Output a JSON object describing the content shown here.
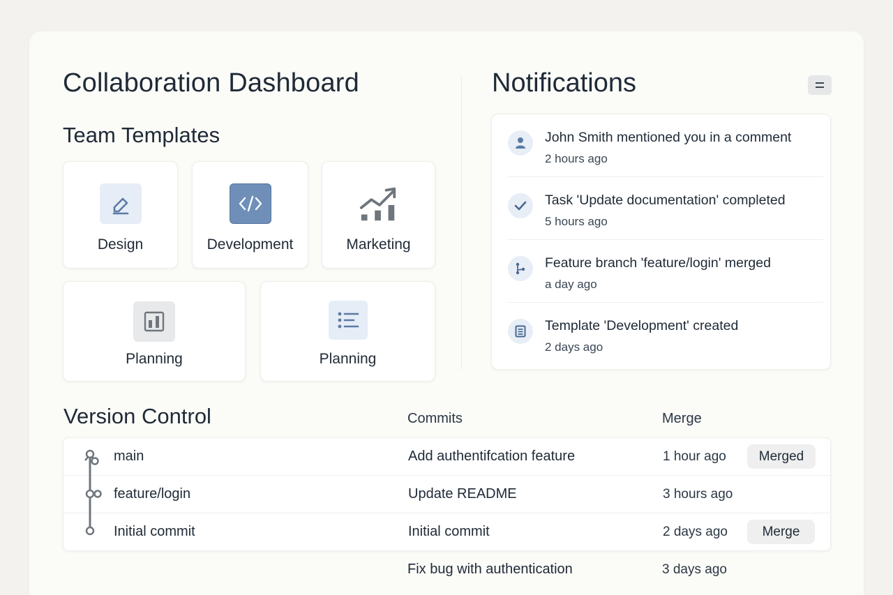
{
  "title": "Collaboration Dashboard",
  "templates": {
    "heading": "Team Templates",
    "items": [
      {
        "label": "Design",
        "icon": "pencil-icon"
      },
      {
        "label": "Development",
        "icon": "code-icon"
      },
      {
        "label": "Marketing",
        "icon": "growth-chart-icon"
      },
      {
        "label": "Planning",
        "icon": "bar-chart-icon"
      },
      {
        "label": "Planning",
        "icon": "list-icon"
      }
    ]
  },
  "notifications": {
    "heading": "Notifications",
    "menu_icon": "menu-icon",
    "items": [
      {
        "text": "John Smith mentioned you in a comment",
        "time": "2 hours ago",
        "icon": "user-icon"
      },
      {
        "text": "Task 'Update documentation' completed",
        "time": "5 hours ago",
        "icon": "check-icon"
      },
      {
        "text": "Feature branch 'feature/login' merged",
        "time": "a day ago",
        "icon": "branch-icon"
      },
      {
        "text": "Template 'Development' created",
        "time": "2 days ago",
        "icon": "document-icon"
      }
    ]
  },
  "version_control": {
    "heading": "Version Control",
    "columns": {
      "commits": "Commits",
      "merge": "Merge"
    },
    "rows": [
      {
        "branch": "main",
        "commit": "Add authentifcation feature",
        "time": "1 hour ago",
        "action": "Merged"
      },
      {
        "branch": "feature/login",
        "commit": "Update README",
        "time": "3 hours ago",
        "action": ""
      },
      {
        "branch": "Initial commit",
        "commit": "Initial commit",
        "time": "2 days ago",
        "action": "Merge"
      }
    ],
    "extra_row": {
      "commit": "Fix bug with authentication",
      "time": "3 days ago"
    }
  },
  "colors": {
    "accent": "#6f8fb8",
    "icon_tile": "#e6edf6",
    "icon_gray": "#6f767d"
  }
}
